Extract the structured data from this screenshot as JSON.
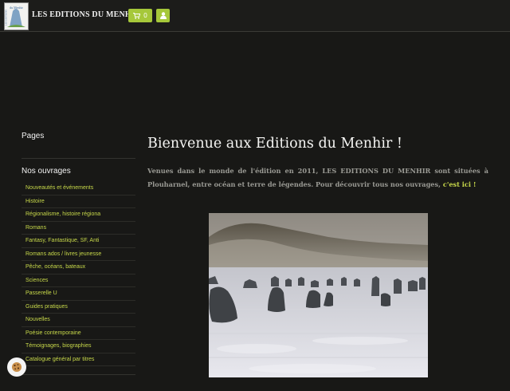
{
  "header": {
    "logo_text": "du Menhir",
    "site_title": "LES EDITIONS DU MENHIR",
    "cart_count": "0",
    "cart_icon": "shopping-cart-icon",
    "user_icon": "user-icon"
  },
  "sidebar": {
    "pages_heading": "Pages",
    "ouvrages_heading": "Nos ouvrages",
    "categories": [
      "Nouveautés et événements",
      "Histoire",
      "Régionalisme, histoire régiona",
      "Romans",
      "Fantasy, Fantastique, SF, Anti",
      "Romans ados / livres jeunesse",
      "Pêche, océans, bateaux",
      "Sciences",
      "Passerelle U",
      "Guides pratiques",
      "Nouvelles",
      "Poésie contemporaine",
      "Témoignages, biographies",
      "Catalogue général par titres"
    ]
  },
  "main": {
    "title": "Bienvenue aux Editions du Menhir !",
    "intro": "Venues dans le monde de l'édition en 2011, LES EDITIONS DU MENHIR sont situées à Plouharnel, entre océan et terre de légendes. Pour découvrir tous nos ouvrages, ",
    "intro_link": "c'est ici !",
    "image_alt": "Menhirs sous la neige"
  },
  "cookie": {
    "icon": "cookie-icon"
  },
  "colors": {
    "accent": "#a6c83a",
    "link": "#c7d84a",
    "background": "#181816",
    "topbar": "#1c1c1a"
  }
}
